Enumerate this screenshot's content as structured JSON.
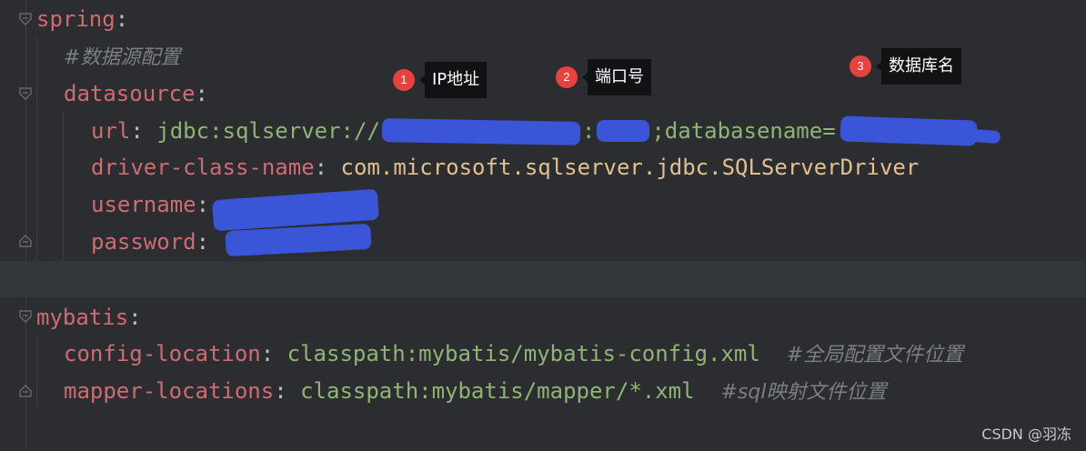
{
  "code": {
    "spring_key": "spring",
    "colon": ":",
    "comment_datasource": "#数据源配置",
    "datasource_key": "datasource",
    "url_key": "url",
    "url_value_prefix": "jdbc:sqlserver://",
    "url_port_sep": ":",
    "url_db_part": ";databasename=",
    "driver_key": "driver-class-name",
    "driver_value": "com.microsoft.sqlserver.jdbc.SQLServerDriver",
    "username_key": "username",
    "password_key": "password",
    "mybatis_key": "mybatis",
    "config_location_key": "config-location",
    "config_location_value": "classpath:mybatis/mybatis-config.xml",
    "config_location_comment": "#全局配置文件位置",
    "mapper_locations_key": "mapper-locations",
    "mapper_locations_value": "classpath:mybatis/mapper/*.xml",
    "mapper_locations_comment": "#sql映射文件位置"
  },
  "annotations": [
    {
      "number": "1",
      "label": "IP地址"
    },
    {
      "number": "2",
      "label": "端口号"
    },
    {
      "number": "3",
      "label": "数据库名"
    }
  ],
  "watermark": "CSDN @羽冻",
  "colors": {
    "background": "#2b2d30",
    "key": "#cf6b73",
    "string": "#8fb573",
    "value": "#e2c08d",
    "comment": "#7a7e85",
    "redaction": "#3b55d9",
    "badge": "#e8423f"
  }
}
